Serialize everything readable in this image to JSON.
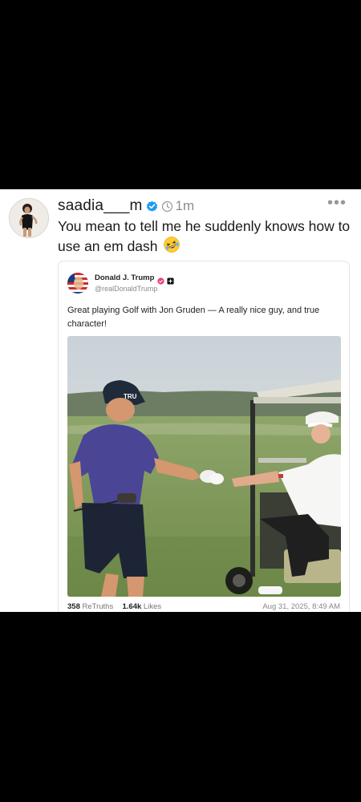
{
  "post": {
    "username": "saadia___m",
    "time": "1m",
    "more": "•••",
    "text": "You mean to tell me he suddenly knows how to use an em dash"
  },
  "quoted": {
    "name": "Donald J. Trump",
    "handle": "@realDonaldTrump",
    "text": "Great playing Golf with Jon Gruden — A really nice guy, and true character!",
    "cap_text": "TRU",
    "retruths_count": "358",
    "retruths_label": "ReTruths",
    "likes_count": "1.64k",
    "likes_label": "Likes",
    "date": "Aug 31, 2025, 8:49 AM"
  },
  "icons": {
    "verified": "verified-check-icon",
    "clock": "clock-icon",
    "emoji": "rofl-emoji-icon",
    "badge": "verified-badge-icon"
  },
  "colors": {
    "verified": "#1d9bf0",
    "trump_badge": "#e8417a"
  }
}
